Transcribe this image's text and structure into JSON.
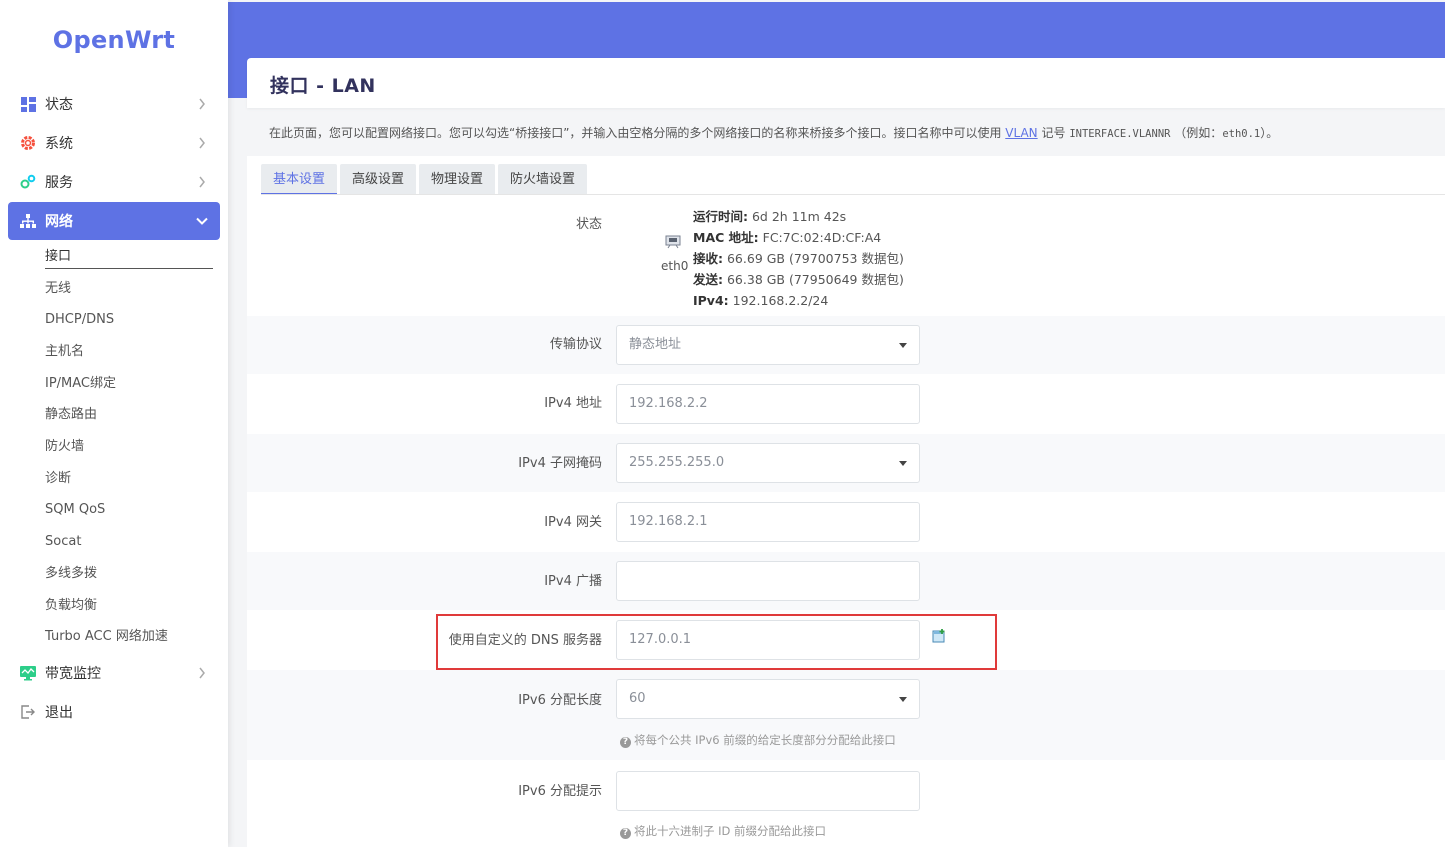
{
  "sidebar": {
    "logo": "OpenWrt",
    "menu": [
      {
        "label": "状态",
        "icon": "dashboard-icon",
        "expanded": false
      },
      {
        "label": "系统",
        "icon": "gear-icon",
        "expanded": false
      },
      {
        "label": "服务",
        "icon": "cogs-icon",
        "expanded": false
      },
      {
        "label": "网络",
        "icon": "network-icon",
        "expanded": true
      },
      {
        "label": "带宽监控",
        "icon": "monitor-icon",
        "expanded": false
      },
      {
        "label": "退出",
        "icon": "logout-icon",
        "expanded": false
      }
    ],
    "network_submenu": [
      "接口",
      "无线",
      "DHCP/DNS",
      "主机名",
      "IP/MAC绑定",
      "静态路由",
      "防火墙",
      "诊断",
      "SQM QoS",
      "Socat",
      "多线多拨",
      "负载均衡",
      "Turbo ACC 网络加速"
    ],
    "active_submenu": "接口"
  },
  "header": {
    "title": "接口 - LAN",
    "description_pre": "在此页面，您可以配置网络接口。您可以勾选“桥接接口”，并输入由空格分隔的多个网络接口的名称来桥接多个接口。接口名称中可以使用",
    "description_link": "VLAN",
    "description_mid": "记号",
    "description_code": "INTERFACE.VLANNR",
    "description_post": "（例如：",
    "description_example": "eth0.1",
    "description_end": "）。"
  },
  "tabs": [
    "基本设置",
    "高级设置",
    "物理设置",
    "防火墙设置"
  ],
  "active_tab": "基本设置",
  "status": {
    "label": "状态",
    "interface": "eth0",
    "uptime_label": "运行时间:",
    "uptime": "6d 2h 11m 42s",
    "mac_label": "MAC 地址:",
    "mac": "FC:7C:02:4D:CF:A4",
    "rx_label": "接收:",
    "rx": "66.69 GB (79700753 数据包)",
    "tx_label": "发送:",
    "tx": "66.38 GB (77950649 数据包)",
    "ipv4_label": "IPv4:",
    "ipv4": "192.168.2.2/24"
  },
  "form": {
    "protocol": {
      "label": "传输协议",
      "value": "静态地址"
    },
    "ipv4_addr": {
      "label": "IPv4 地址",
      "value": "192.168.2.2"
    },
    "ipv4_mask": {
      "label": "IPv4 子网掩码",
      "value": "255.255.255.0"
    },
    "ipv4_gw": {
      "label": "IPv4 网关",
      "value": "192.168.2.1"
    },
    "ipv4_bcast": {
      "label": "IPv4 广播",
      "value": ""
    },
    "dns": {
      "label": "使用自定义的 DNS 服务器",
      "value": "127.0.0.1"
    },
    "ip6_assign": {
      "label": "IPv6 分配长度",
      "value": "60",
      "hint": "将每个公共 IPv6 前缀的给定长度部分分配给此接口"
    },
    "ip6_hint": {
      "label": "IPv6 分配提示",
      "value": "",
      "hint": "将此十六进制子 ID 前缀分配给此接口"
    }
  },
  "colors": {
    "accent": "#5e72e4",
    "highlight": "#e03a3a"
  }
}
